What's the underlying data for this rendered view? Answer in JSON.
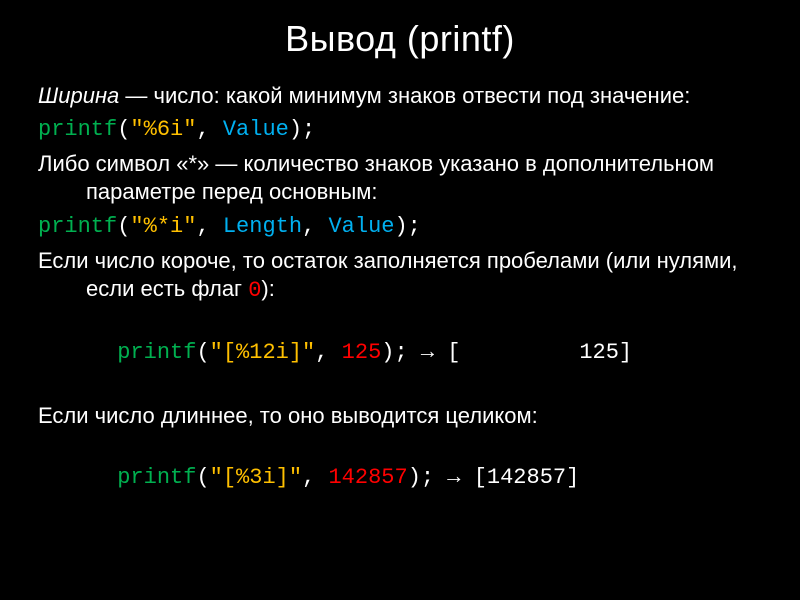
{
  "slide": {
    "title": "Вывод (printf)",
    "p1_a": "Ширина",
    "p1_b": " — число: какой минимум знаков отвести под значение:",
    "code1": {
      "a": "printf",
      "b": "(",
      "c": "\"%6i\"",
      "d": ", ",
      "e": "Value",
      "f": ");"
    },
    "p2": "Либо символ «*» — количество знаков указано в дополнительном параметре перед основным:",
    "code2": {
      "a": "printf",
      "b": "(",
      "c": "\"%*i\"",
      "d": ", ",
      "e": "Length",
      "f": ", ",
      "g": "Value",
      "h": ");"
    },
    "p3_a": "Если число короче, то остаток заполняется пробелами (или нулями, если есть флаг ",
    "p3_flag": "0",
    "p3_b": "):",
    "code3": {
      "a": "printf",
      "b": "(",
      "c": "\"[%12i]\"",
      "d": ", ",
      "e": "125",
      "f": ");",
      "g": " → ",
      "h": "[         125]"
    },
    "p4": "Если число длиннее, то оно выводится целиком:",
    "code4": {
      "a": "printf",
      "b": "(",
      "c": "\"[%3i]\"",
      "d": ", ",
      "e": "142857",
      "f": ");",
      "g": " → ",
      "h": "[142857]"
    }
  }
}
